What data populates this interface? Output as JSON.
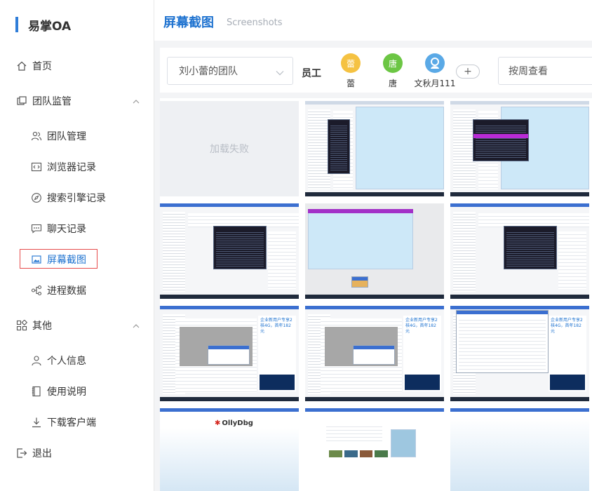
{
  "app": {
    "brand": "易掌OA"
  },
  "header": {
    "title": "屏幕截图",
    "subtitle": "Screenshots"
  },
  "sidebar": {
    "home": "首页",
    "team_group": "团队监管",
    "team_items": [
      "团队管理",
      "浏览器记录",
      "搜索引擎记录",
      "聊天记录",
      "屏幕截图",
      "进程数据"
    ],
    "other_group": "其他",
    "other_items": [
      "个人信息",
      "使用说明",
      "下载客户端"
    ],
    "logout": "退出",
    "active_item": "屏幕截图"
  },
  "filters": {
    "team_select": "刘小蕾的团队",
    "employee_label": "员工",
    "employees": [
      {
        "name": "蕾",
        "avatar_text": "蕾",
        "color": "#f5c242"
      },
      {
        "name": "唐",
        "avatar_text": "唐",
        "color": "#6cc644"
      },
      {
        "name": "文秋月111",
        "avatar_text": "",
        "color": "#5aa9e6"
      }
    ],
    "add_button": "+",
    "week_select": "按周查看"
  },
  "grid": {
    "failed_text": "加载失败",
    "ad_text": "企业新用户专享2核4G，首年182元",
    "ollydbg_text": "OllyDbg"
  },
  "colors": {
    "accent": "#1f73d0",
    "active_outline": "#e64b4b"
  }
}
